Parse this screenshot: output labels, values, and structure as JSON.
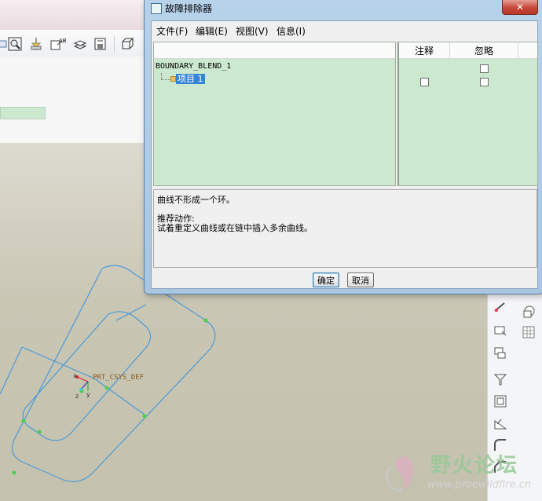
{
  "dialog": {
    "title": "故障排除器",
    "close_glyph": "✕",
    "menu": [
      "文件(F)",
      "编辑(E)",
      "视图(V)",
      "信息(I)"
    ],
    "columns": {
      "note": "注释",
      "ignore": "忽略"
    },
    "tree": {
      "root": "BOUNDARY_BLEND_1",
      "child": "项目 1"
    },
    "message": {
      "error": "曲线不形成一个环。",
      "action_title": "推荐动作:",
      "action_text": "试着重定义曲线或在链中插入多余曲线。"
    },
    "buttons": {
      "ok": "确定",
      "cancel": "取消"
    }
  },
  "viewport": {
    "csys_label": "PRT_CSYS_DEF",
    "axis_x": "x",
    "axis_y": "y",
    "axis_z": "z"
  },
  "watermark": {
    "text": "野火论坛",
    "url": "www.proewildfire.cn"
  },
  "colors": {
    "tree_bg": "#cce8cf",
    "selection": "#3385d6",
    "curve": "#4a9ad8",
    "curve_vertex": "#4ccf4c"
  },
  "icons": {
    "toolbar": [
      "zoom-fit-icon",
      "spin-center-icon",
      "orient-icon",
      "layers-icon",
      "saved-views-icon",
      "view-3d-icon"
    ],
    "right_toolbar": [
      "sketch-icon",
      "datum-plane-icon",
      "datum-point-icon",
      "csys-icon",
      "draft-icon",
      "shell-icon",
      "rib-icon",
      "round-icon",
      "chamfer-icon"
    ]
  }
}
